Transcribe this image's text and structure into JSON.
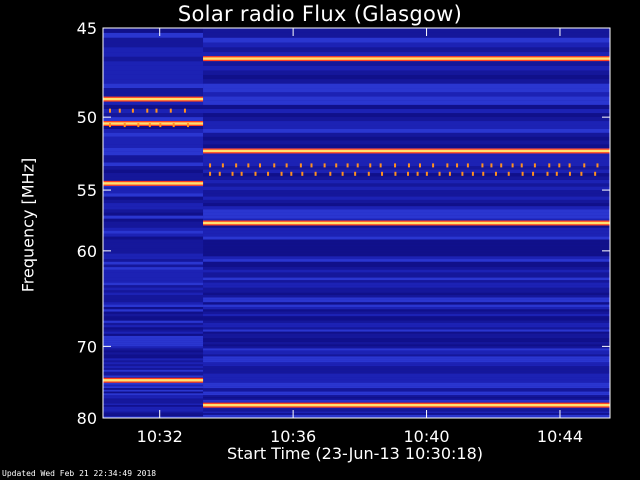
{
  "chart_data": {
    "type": "heatmap",
    "title": "Solar radio Flux (Glasgow)",
    "ylabel": "Frequency [MHz]",
    "xlabel": "Start Time (23-Jun-13 10:30:18)",
    "footer": "Updated Wed Feb 21 22:34:49 2018",
    "y_axis": {
      "range": [
        45,
        80
      ],
      "ticks": [
        45,
        50,
        55,
        60,
        70,
        80
      ],
      "tick_labels": [
        "45",
        "50",
        "55",
        "60",
        "70",
        "80"
      ]
    },
    "x_axis": {
      "range_minutes": [
        0,
        15.2
      ],
      "ticks_minutes": [
        1.7,
        5.7,
        9.7,
        13.7
      ],
      "tick_labels": [
        "10:32",
        "10:36",
        "10:40",
        "10:44"
      ]
    },
    "segments": [
      {
        "start_min": 0,
        "end_min": 3.0,
        "emission_lines_mhz": [
          48.9,
          50.4,
          54.5,
          74.4
        ],
        "burst_marks_mhz": [
          49.6,
          50.5
        ]
      },
      {
        "start_min": 3.0,
        "end_min": 15.2,
        "emission_lines_mhz": [
          46.6,
          52.2,
          57.6,
          78.0
        ],
        "burst_marks_mhz": [
          53.2,
          53.8
        ]
      }
    ],
    "colors": {
      "background": "#000000",
      "plot_base": "#1a1aa8",
      "hot": "#ffe070",
      "line": "#ff4020"
    }
  }
}
